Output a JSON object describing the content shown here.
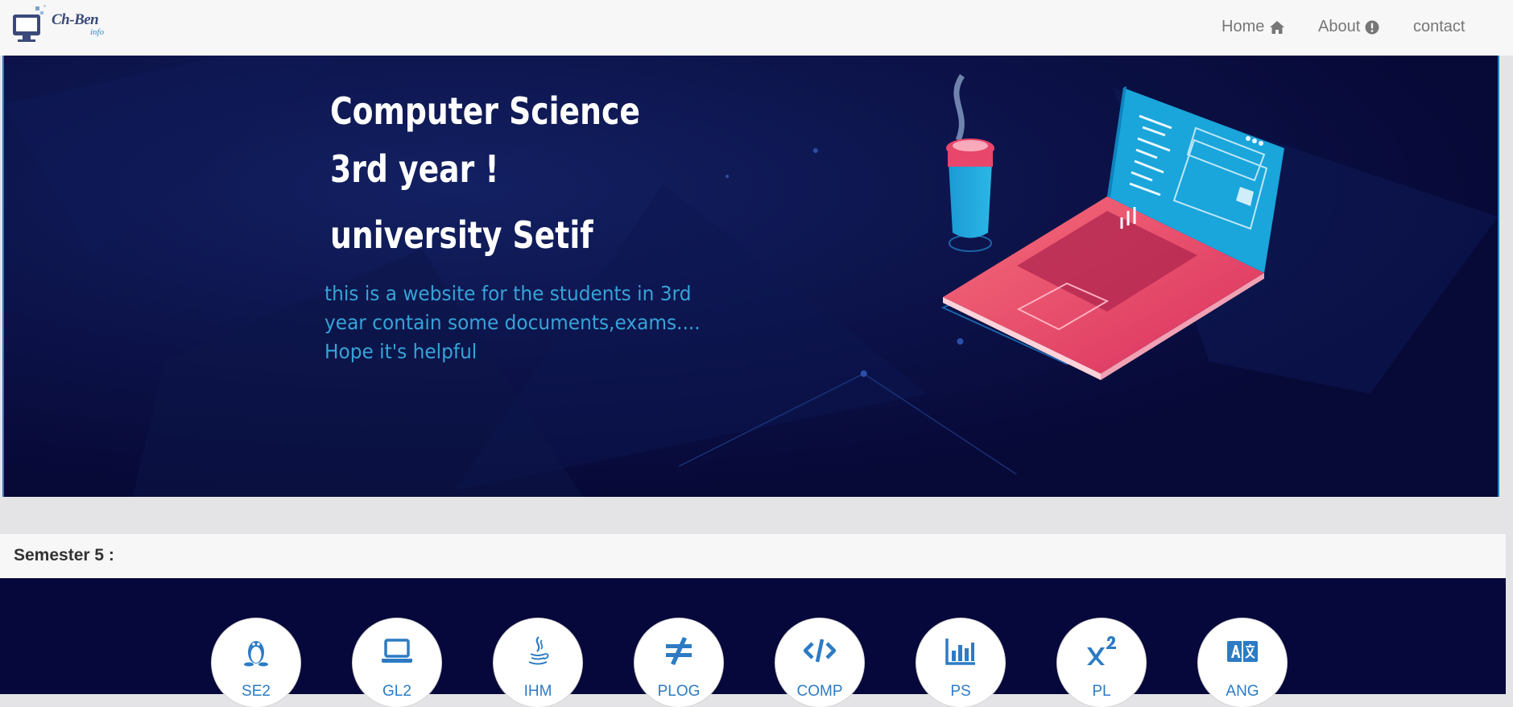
{
  "navbar": {
    "logo_text": "Ch-Ben",
    "logo_sub": "info",
    "links": [
      {
        "label": "Home",
        "icon": "home-icon"
      },
      {
        "label": "About",
        "icon": "info-circle-icon"
      },
      {
        "label": "contact",
        "icon": ""
      }
    ]
  },
  "hero": {
    "title_line1": "Computer Science",
    "title_line2": "3rd year !",
    "title_line3": "university Setif",
    "description": [
      "this is a website for the students in 3rd",
      " year contain some documents,exams....",
      "Hope it's helpful"
    ]
  },
  "semester": {
    "label": "Semester 5 :"
  },
  "subjects": [
    {
      "label": "SE2",
      "icon": "linux-icon"
    },
    {
      "label": "GL2",
      "icon": "laptop-icon"
    },
    {
      "label": "IHM",
      "icon": "java-icon"
    },
    {
      "label": "PLOG",
      "icon": "not-equal-icon"
    },
    {
      "label": "COMP",
      "icon": "code-icon"
    },
    {
      "label": "PS",
      "icon": "bar-chart-icon"
    },
    {
      "label": "PL",
      "icon": "superscript-icon"
    },
    {
      "label": "ANG",
      "icon": "language-icon"
    }
  ],
  "colors": {
    "hero_bg": "#090b3a",
    "accent_blue": "#2d7bc4",
    "hero_text_blue": "#36a3d8",
    "laptop_pink": "#f0566e",
    "screen_blue": "#1aa5db"
  }
}
